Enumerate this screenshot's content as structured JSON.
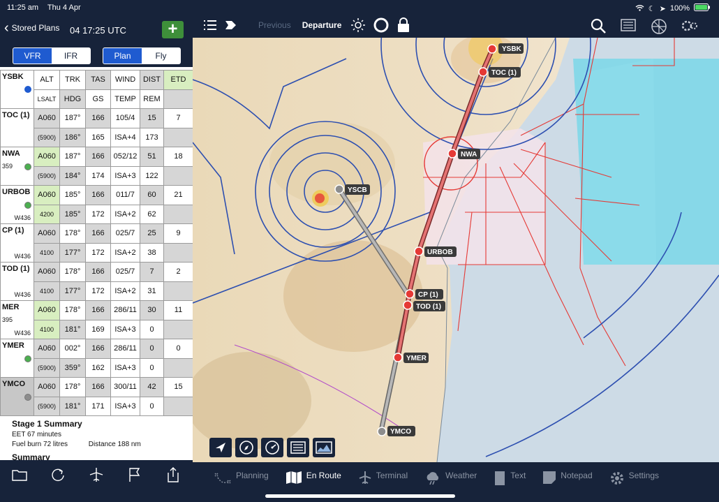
{
  "status": {
    "time": "11:25 am",
    "date": "Thu 4 Apr",
    "battery": "100%"
  },
  "header": {
    "back_label": "Stored Plans",
    "plan_date": "04 17:25 UTC",
    "add_label": "+"
  },
  "rules_toggle": [
    "VFR",
    "IFR"
  ],
  "mode_toggle": [
    "Plan",
    "Fly"
  ],
  "table_header": {
    "origin": "YSBK",
    "row1": [
      "ALT",
      "TRK",
      "TAS",
      "WIND",
      "DIST",
      "ETD"
    ],
    "row2": [
      "LSALT",
      "HDG",
      "GS",
      "TEMP",
      "REM",
      ""
    ]
  },
  "waypoints": [
    {
      "name": "TOC (1)",
      "sub": "",
      "airway": "",
      "alt": "A060",
      "lsalt": "(5900)",
      "trk": "187°",
      "hdg": "186°",
      "tas": "166",
      "gs": "165",
      "wind": "105/4",
      "temp": "ISA+4",
      "dist": "15",
      "rem": "173",
      "etd": "7"
    },
    {
      "name": "NWA",
      "sub": "359",
      "airway": "",
      "alt": "A060",
      "lsalt": "(5900)",
      "trk": "187°",
      "hdg": "184°",
      "tas": "166",
      "gs": "174",
      "wind": "052/12",
      "temp": "ISA+3",
      "dist": "51",
      "rem": "122",
      "etd": "18"
    },
    {
      "name": "URBOB",
      "sub": "",
      "airway": "W436",
      "alt": "A060",
      "lsalt": "4200",
      "trk": "185°",
      "hdg": "185°",
      "tas": "166",
      "gs": "172",
      "wind": "011/7",
      "temp": "ISA+2",
      "dist": "60",
      "rem": "62",
      "etd": "21"
    },
    {
      "name": "CP (1)",
      "sub": "",
      "airway": "W436",
      "alt": "A060",
      "lsalt": "4100",
      "trk": "178°",
      "hdg": "177°",
      "tas": "166",
      "gs": "172",
      "wind": "025/7",
      "temp": "ISA+2",
      "dist": "25",
      "rem": "38",
      "etd": "9"
    },
    {
      "name": "TOD (1)",
      "sub": "",
      "airway": "W436",
      "alt": "A060",
      "lsalt": "4100",
      "trk": "178°",
      "hdg": "177°",
      "tas": "166",
      "gs": "172",
      "wind": "025/7",
      "temp": "ISA+2",
      "dist": "7",
      "rem": "31",
      "etd": "2"
    },
    {
      "name": "MER",
      "sub": "395",
      "airway": "W436",
      "alt": "A060",
      "lsalt": "4100",
      "trk": "178°",
      "hdg": "181°",
      "tas": "166",
      "gs": "169",
      "wind": "286/11",
      "temp": "ISA+3",
      "dist": "30",
      "rem": "0",
      "etd": "11"
    },
    {
      "name": "YMER",
      "sub": "",
      "airway": "",
      "alt": "A060",
      "lsalt": "(5900)",
      "trk": "002°",
      "hdg": "359°",
      "tas": "166",
      "gs": "162",
      "wind": "286/11",
      "temp": "ISA+3",
      "dist": "0",
      "rem": "0",
      "etd": "0"
    },
    {
      "name": "YMCO",
      "sub": "",
      "airway": "",
      "alt": "A060",
      "lsalt": "(5900)",
      "trk": "178°",
      "hdg": "181°",
      "tas": "166",
      "gs": "171",
      "wind": "300/11",
      "temp": "ISA+3",
      "dist": "42",
      "rem": "0",
      "etd": "15"
    }
  ],
  "summary": {
    "title": "Stage 1 Summary",
    "eet": "EET 67 minutes",
    "fuel": "Fuel burn 72 litres",
    "distance": "Distance 188 nm",
    "title2": "Summary"
  },
  "map_nav": {
    "previous": "Previous",
    "current": "Departure"
  },
  "map_labels": [
    "YSBK",
    "TOC (1)",
    "NWA",
    "YSCB",
    "URBOB",
    "CP (1)",
    "TOD (1)",
    "YMER",
    "YMCO"
  ],
  "tabs": [
    {
      "label": "Planning",
      "icon": "planning-icon",
      "active": false
    },
    {
      "label": "En Route",
      "icon": "map-icon",
      "active": true
    },
    {
      "label": "Terminal",
      "icon": "plane-icon",
      "active": false
    },
    {
      "label": "Weather",
      "icon": "cloud-icon",
      "active": false
    },
    {
      "label": "Text",
      "icon": "book-icon",
      "active": false
    },
    {
      "label": "Notepad",
      "icon": "notepad-icon",
      "active": false
    },
    {
      "label": "Settings",
      "icon": "gear-icon",
      "active": false
    }
  ],
  "colors": {
    "accent": "#1f5bd0",
    "add_green": "#3e8f3a",
    "route_red": "#e53935",
    "bar_navy": "#17233a"
  }
}
